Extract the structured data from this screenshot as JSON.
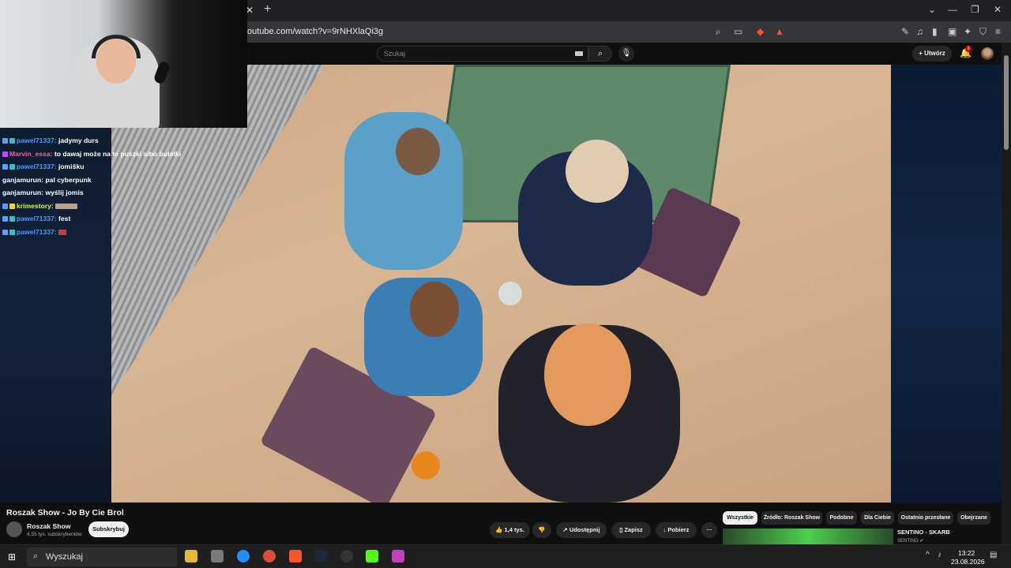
{
  "browser": {
    "url": "outube.com/watch?v=9rNHXlaQi3g",
    "tab_close": "✕",
    "new_tab": "+"
  },
  "youtube": {
    "search_placeholder": "Szukaj",
    "create_label": "Utwórz",
    "notifications_count": "3"
  },
  "chat": [
    {
      "user": "pawel71337:",
      "user_color": "#4a9bff",
      "msg": "jadymy durs",
      "badges": [
        "#5aa0ff",
        "#36c0c0"
      ]
    },
    {
      "user": "Marvin_essa:",
      "user_color": "#ff5a9c",
      "msg": "to dawaj może na te puszki albo butelki",
      "badges": [
        "#c04aff"
      ]
    },
    {
      "user": "pawel71337:",
      "user_color": "#4a9bff",
      "msg": "jomišku",
      "badges": [
        "#5aa0ff",
        "#36c0c0"
      ]
    },
    {
      "user": "ganjamurun:",
      "user_color": "#ffffff",
      "msg": "pal cyberpunk",
      "badges": []
    },
    {
      "user": "ganjamurun:",
      "user_color": "#ffffff",
      "msg": "wyślij jomis",
      "badges": []
    },
    {
      "user": "krimestory:",
      "user_color": "#c8ff3a",
      "msg": "",
      "badges": [
        "#5aa0ff",
        "#ffd12a"
      ]
    },
    {
      "user": "pawel71337:",
      "user_color": "#4a9bff",
      "msg": "fest",
      "badges": [
        "#5aa0ff",
        "#36c0c0"
      ]
    },
    {
      "user": "pawel71337:",
      "user_color": "#4a9bff",
      "msg": "",
      "badges": [
        "#5aa0ff",
        "#36c0c0"
      ]
    }
  ],
  "video": {
    "title": "Roszak Show - Jo By Cie Brol",
    "channel": "Roszak Show",
    "subscribers": "4,55 tys. subskrybentów",
    "subscribe_label": "Subskrybuj",
    "likes": "1,4 tys.",
    "share_label": "Udostępnij",
    "save_label": "Zapisz",
    "download_label": "Pobierz",
    "more_label": "···"
  },
  "chips": [
    "Wszystkie",
    "Źródło: Roszak Show",
    "Podobne",
    "Dla Ciebie",
    "Ostatnio przesłane",
    "Obejrzane"
  ],
  "recommended": {
    "title": "SENTINO - SKARB",
    "channel": "SENTINO ✔"
  },
  "taskbar": {
    "search_placeholder": "Wyszukaj",
    "time": "13:22",
    "date": "23.08.2026"
  }
}
